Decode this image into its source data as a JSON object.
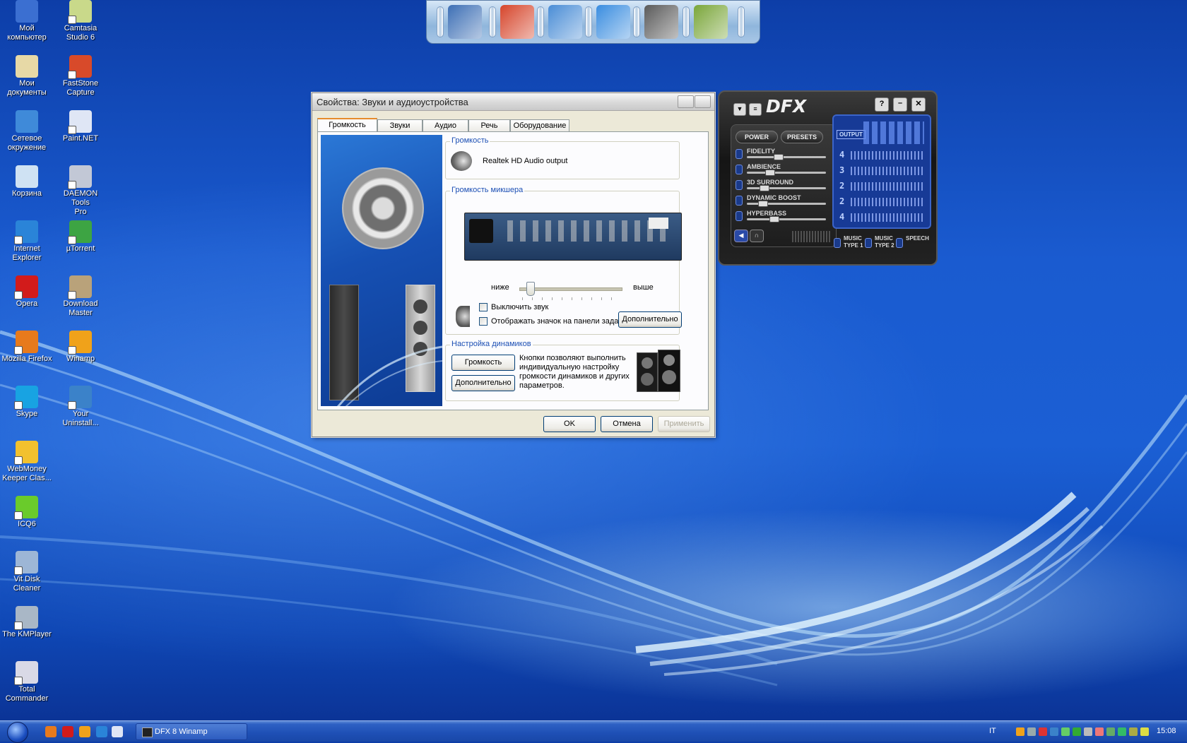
{
  "desktop": {
    "icons_col1": [
      {
        "name": "computer-icon",
        "label": "Мой\nкомпьютер",
        "color": "#3b6fd1"
      },
      {
        "name": "documents-icon",
        "label": "Мои\nдокументы",
        "color": "#e7d9a6"
      },
      {
        "name": "network-icon",
        "label": "Сетевое\nокружение",
        "color": "#3f8ad9"
      },
      {
        "name": "recycle-bin-icon",
        "label": "Корзина",
        "color": "#cfe2f3"
      },
      {
        "name": "internet-explorer-icon",
        "label": "Internet\nExplorer",
        "color": "#2a84d8"
      },
      {
        "name": "opera-icon",
        "label": "Opera",
        "color": "#d21b1b"
      },
      {
        "name": "firefox-icon",
        "label": "Mozilla Firefox",
        "color": "#e77a1c"
      },
      {
        "name": "skype-icon",
        "label": "Skype",
        "color": "#18a3e2"
      },
      {
        "name": "webmoney-icon",
        "label": "WebMoney\nKeeper Clas...",
        "color": "#f2c12e"
      },
      {
        "name": "icq-icon",
        "label": "ICQ6",
        "color": "#6acb2b"
      },
      {
        "name": "vit-disk-cleaner-icon",
        "label": "Vit Disk\nCleaner",
        "color": "#9db6d6"
      },
      {
        "name": "kmplayer-icon",
        "label": "The KMPlayer",
        "color": "#a9b7c6"
      },
      {
        "name": "total-commander-icon",
        "label": "Total\nCommander",
        "color": "#d9d9e6"
      }
    ],
    "icons_col2": [
      {
        "name": "camtasia-icon",
        "label": "Camtasia\nStudio 6",
        "color": "#c9d98a"
      },
      {
        "name": "faststone-icon",
        "label": "FastStone\nCapture",
        "color": "#d84a2a"
      },
      {
        "name": "paint-net-icon",
        "label": "Paint.NET",
        "color": "#dfe6f5"
      },
      {
        "name": "daemon-tools-icon",
        "label": "DAEMON Tools\nPro",
        "color": "#c2c8d6"
      },
      {
        "name": "utorrent-icon",
        "label": "µTorrent",
        "color": "#3da443"
      },
      {
        "name": "download-master-icon",
        "label": "Download\nMaster",
        "color": "#b9a27a"
      },
      {
        "name": "winamp-icon",
        "label": "Winamp",
        "color": "#f0a21a"
      },
      {
        "name": "your-uninstaller-icon",
        "label": "Your\nUninstall...",
        "color": "#3b82c9"
      }
    ]
  },
  "dock": {
    "items": [
      {
        "name": "dock-computer-icon",
        "color": "#3d6fb5"
      },
      {
        "name": "dock-filezilla-icon",
        "color": "#d6452b"
      },
      {
        "name": "dock-globe-icon",
        "color": "#4a8dd6"
      },
      {
        "name": "dock-upload-arrow-icon",
        "color": "#3a8de0"
      },
      {
        "name": "dock-photoshop-icon",
        "color": "#5a5a5a"
      },
      {
        "name": "dock-dreamweaver-icon",
        "color": "#7aa63a"
      }
    ]
  },
  "dialog": {
    "title": "Свойства: Звуки и аудиоустройства",
    "tabs": [
      "Громкость",
      "Звуки",
      "Аудио",
      "Речь",
      "Оборудование"
    ],
    "device_group_title": "Громкость",
    "device_name": "Realtek HD Audio output",
    "mixer_group_title": "Громкость микшера",
    "slider_low": "ниже",
    "slider_high": "выше",
    "mute_label": "Выключить звук",
    "tray_icon_label": "Отображать значок на панели задач",
    "advanced_button": "Дополнительно",
    "speakers_group_title": "Настройка динамиков",
    "speakers_volume_button": "Громкость",
    "speakers_advanced_button": "Дополнительно",
    "speakers_description": "Кнопки позволяют выполнить индивидуальную настройку громкости динамиков и других параметров.",
    "ok_button": "OK",
    "cancel_button": "Отмена",
    "apply_button": "Применить"
  },
  "dfx": {
    "logo": "DFX",
    "power_label": "POWER",
    "presets_label": "PRESETS",
    "output_label": "OUTPUT",
    "sliders": [
      {
        "label": "FIDELITY",
        "value": "4"
      },
      {
        "label": "AMBIENCE",
        "value": "3"
      },
      {
        "label": "3D SURROUND",
        "value": "2"
      },
      {
        "label": "DYNAMIC BOOST",
        "value": "2"
      },
      {
        "label": "HYPERBASS",
        "value": "4"
      }
    ],
    "modes": [
      {
        "line1": "MUSIC",
        "line2": "TYPE 1"
      },
      {
        "line1": "MUSIC",
        "line2": "TYPE 2"
      },
      {
        "line1": "SPEECH",
        "line2": ""
      }
    ]
  },
  "taskbar": {
    "task_label": "DFX 8 Winamp",
    "language": "IT",
    "clock": "15:08"
  }
}
